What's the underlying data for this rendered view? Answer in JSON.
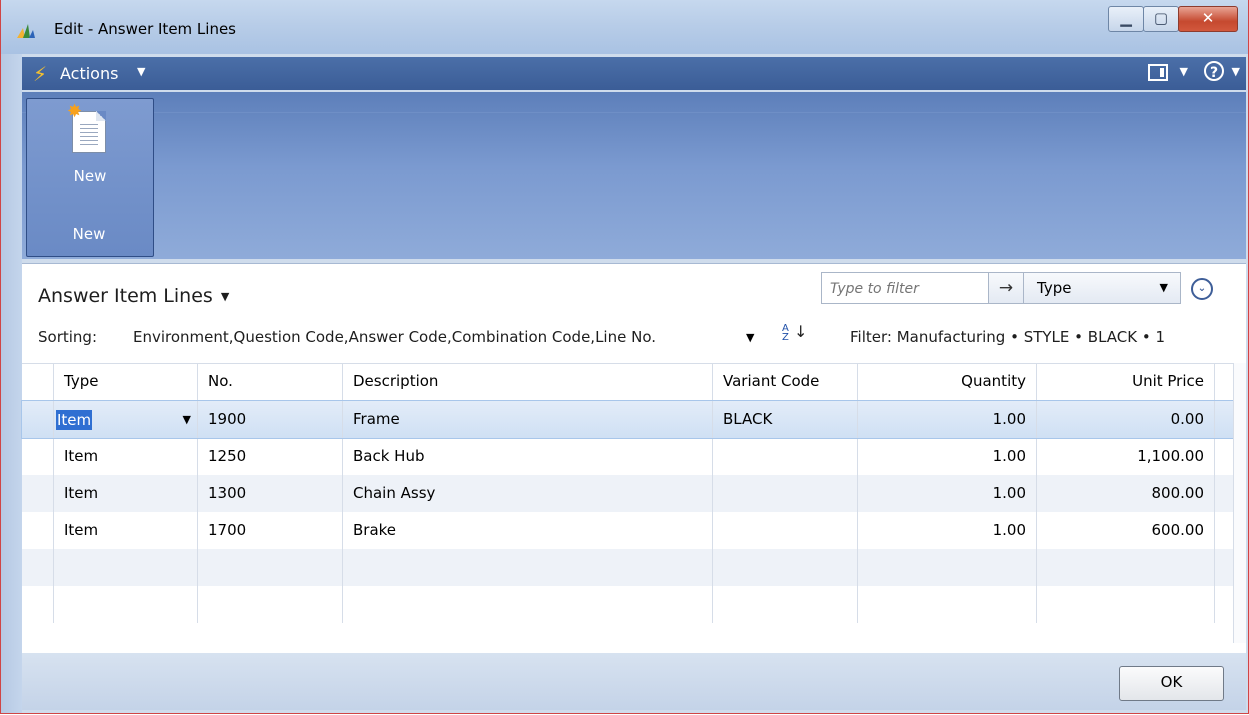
{
  "window": {
    "title": "Edit - Answer Item Lines",
    "controls": [
      "minimize",
      "maximize",
      "close"
    ]
  },
  "actions_bar": {
    "label": "Actions",
    "layout_icon": "layout-icon",
    "help_icon": "help-icon"
  },
  "ribbon": {
    "buttons": [
      {
        "label": "New",
        "icon": "new-document-icon"
      }
    ],
    "group_label": "New"
  },
  "page": {
    "title": "Answer Item Lines",
    "filter_placeholder": "Type to filter",
    "filter_field": "Type",
    "sorting_label": "Sorting:",
    "sorting_value": "Environment,Question Code,Answer Code,Combination Code,Line No.",
    "filter_text": "Filter: Manufacturing • STYLE • BLACK • 1"
  },
  "table": {
    "columns": [
      "Type",
      "No.",
      "Description",
      "Variant Code",
      "Quantity",
      "Unit Price"
    ],
    "rows": [
      {
        "type": "Item",
        "no": "1900",
        "description": "Frame",
        "variant": "BLACK",
        "quantity": "1.00",
        "unit_price": "0.00"
      },
      {
        "type": "Item",
        "no": "1250",
        "description": "Back Hub",
        "variant": "",
        "quantity": "1.00",
        "unit_price": "1,100.00"
      },
      {
        "type": "Item",
        "no": "1300",
        "description": "Chain Assy",
        "variant": "",
        "quantity": "1.00",
        "unit_price": "800.00"
      },
      {
        "type": "Item",
        "no": "1700",
        "description": "Brake",
        "variant": "",
        "quantity": "1.00",
        "unit_price": "600.00"
      }
    ]
  },
  "footer": {
    "ok_label": "OK"
  }
}
